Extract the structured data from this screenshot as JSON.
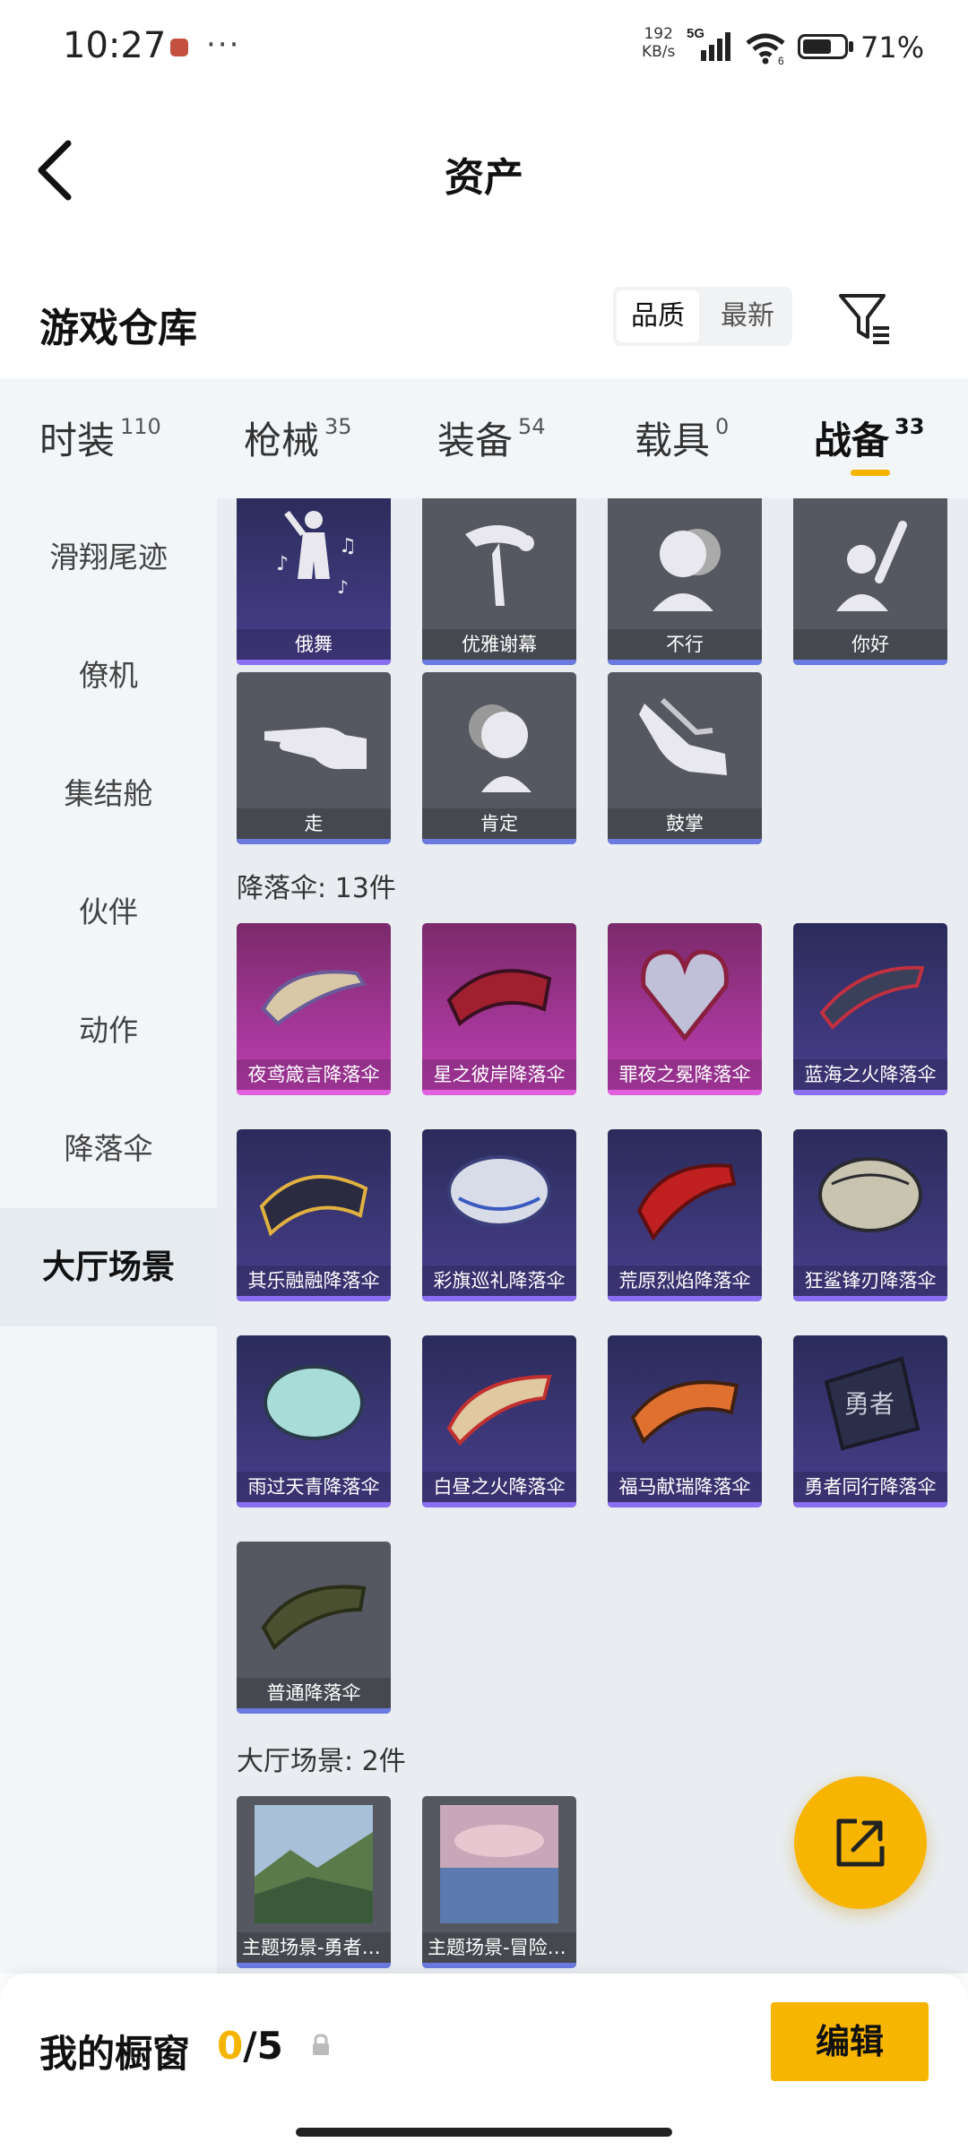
{
  "status": {
    "time": "10:27",
    "speed_top": "192",
    "speed_unit": "KB/s",
    "network": "5G",
    "wifi_sub": "6",
    "battery": "71%",
    "battery_level": 0.71
  },
  "header": {
    "title": "资产"
  },
  "warehouse": {
    "title": "游戏仓库",
    "sort": [
      "品质",
      "最新"
    ]
  },
  "tabs": [
    {
      "label": "时装",
      "count": "110"
    },
    {
      "label": "枪械",
      "count": "35"
    },
    {
      "label": "装备",
      "count": "54"
    },
    {
      "label": "载具",
      "count": "0"
    },
    {
      "label": "战备",
      "count": "33"
    }
  ],
  "sidebar": [
    "滑翔尾迹",
    "僚机",
    "集结舱",
    "伙伴",
    "动作",
    "降落伞",
    "大厅场景"
  ],
  "actions": [
    "俄舞",
    "优雅谢幕",
    "不行",
    "你好",
    "走",
    "肯定",
    "鼓掌"
  ],
  "parachute_section": "降落伞: 13件",
  "parachutes": [
    "夜鸢箴言降落伞",
    "星之彼岸降落伞",
    "罪夜之冕降落伞",
    "蓝海之火降落伞",
    "其乐融融降落伞",
    "彩旗巡礼降落伞",
    "荒原烈焰降落伞",
    "狂鲨锋刃降落伞",
    "雨过天青降落伞",
    "白昼之火降落伞",
    "福马献瑞降落伞",
    "勇者同行降落伞",
    "普通降落伞"
  ],
  "lobby_section": "大厅场景: 2件",
  "lobby": [
    "主题场景-勇者之境",
    "主题场景-冒险之旅"
  ],
  "bottom": {
    "title": "我的橱窗",
    "current": "0",
    "total": "/5",
    "edit": "编辑"
  },
  "colors": {
    "accent": "#f7b500"
  }
}
